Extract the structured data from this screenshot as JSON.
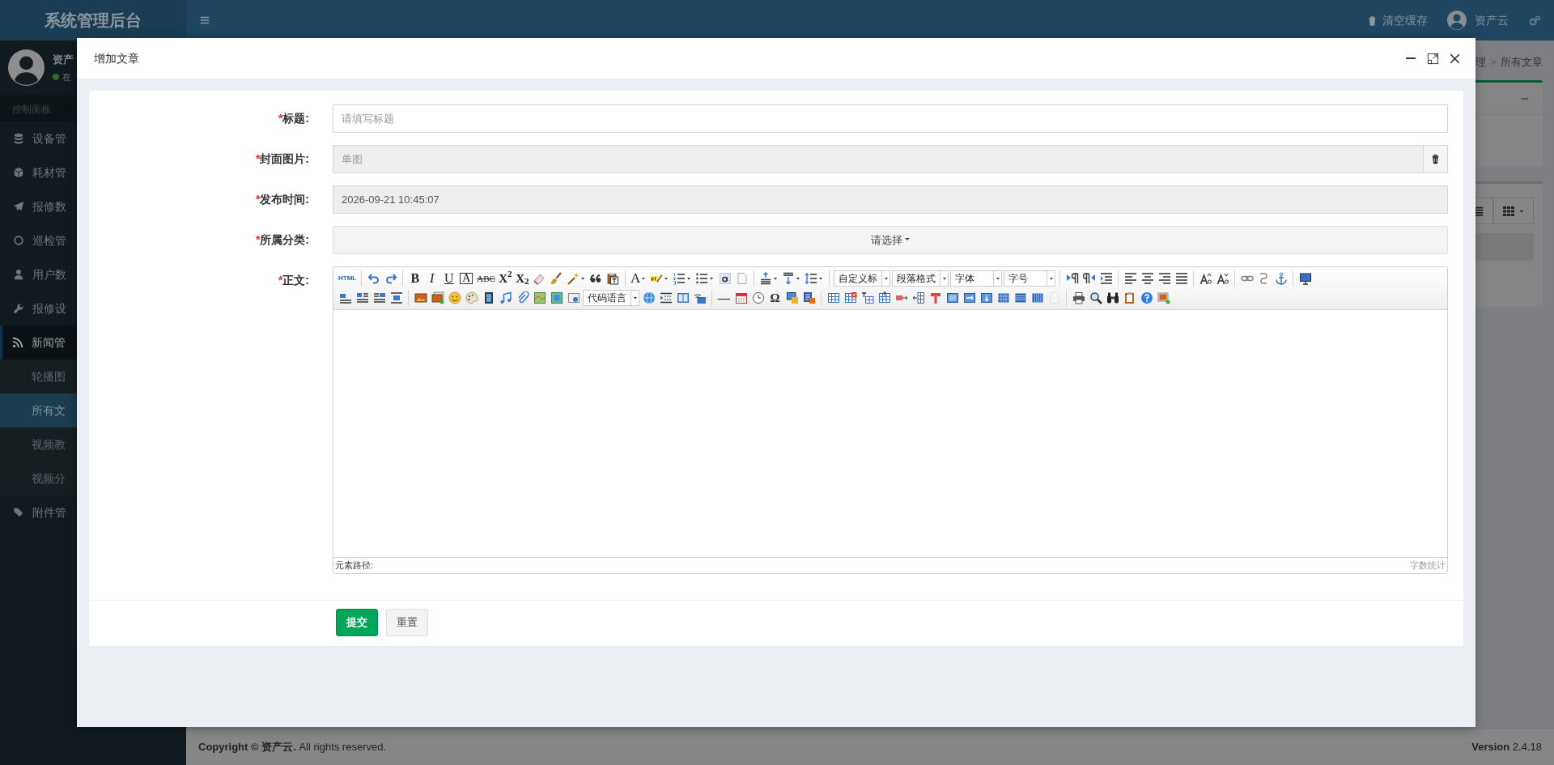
{
  "header": {
    "logo": "系统管理后台",
    "clear_cache": "清空缓存",
    "user": "资产云"
  },
  "sidebar": {
    "user": "资产",
    "status": "在",
    "online": true,
    "section": "控制面板",
    "items": [
      {
        "label": "设备管",
        "expanded": false
      },
      {
        "label": "耗材管",
        "expanded": false
      },
      {
        "label": "报修数",
        "expanded": false
      },
      {
        "label": "巡检管",
        "expanded": false
      },
      {
        "label": "用户数",
        "expanded": false
      },
      {
        "label": "报修设",
        "expanded": false
      },
      {
        "label": "新闻管",
        "expanded": true,
        "children": [
          {
            "label": "轮播图",
            "selected": false
          },
          {
            "label": "所有文",
            "selected": true
          },
          {
            "label": "视频教",
            "selected": false
          },
          {
            "label": "视频分",
            "selected": false
          }
        ]
      },
      {
        "label": "附件管",
        "expanded": false
      }
    ]
  },
  "content": {
    "breadcrumb": [
      {
        "label": "理"
      },
      {
        "label": "所有文章"
      }
    ],
    "separator": ">"
  },
  "modal": {
    "title": "增加文章",
    "fields": [
      {
        "kind": "text",
        "required_mark": "*",
        "label": "标题:",
        "placeholder": "请填写标题"
      },
      {
        "kind": "image",
        "required_mark": "*",
        "label": "封面图片:",
        "placeholder": "单图"
      },
      {
        "kind": "datetime",
        "required_mark": "*",
        "label": "发布时间:",
        "value": "2026-09-21 10:45:07"
      },
      {
        "kind": "select",
        "required_mark": "*",
        "label": "所属分类:",
        "value": "请选择"
      },
      {
        "kind": "editor",
        "required_mark": "*",
        "label": "正文:"
      }
    ],
    "editor": {
      "toolbar": [
        [
          {
            "kind": "small",
            "text": "HTML"
          },
          {
            "kind": "sep"
          },
          {
            "kind": "icon"
          },
          {
            "kind": "icon"
          },
          {
            "kind": "sep"
          },
          {
            "kind": "bold",
            "text": "B"
          },
          {
            "kind": "italic",
            "text": "I"
          },
          {
            "kind": "underline",
            "text": "U"
          },
          {
            "kind": "boxed",
            "text": "A"
          },
          {
            "kind": "struck",
            "text": "ABC"
          },
          {
            "kind": "glyph",
            "text": "X$^{2}$"
          },
          {
            "kind": "glyph",
            "text": "X$_{2}$"
          },
          {
            "kind": "icon"
          },
          {
            "kind": "icon"
          },
          {
            "kind": "menuicon"
          },
          {
            "kind": "icon"
          },
          {
            "kind": "icon"
          },
          {
            "kind": "sep"
          },
          {
            "kind": "menuglyph",
            "text": "A"
          },
          {
            "kind": "menuicon"
          },
          {
            "kind": "menuicon"
          },
          {
            "kind": "menuicon"
          },
          {
            "kind": "icon"
          },
          {
            "kind": "icon"
          },
          {
            "kind": "sep"
          },
          {
            "kind": "menuicon"
          },
          {
            "kind": "menuicon"
          },
          {
            "kind": "menuicon"
          },
          {
            "kind": "sep"
          },
          {
            "kind": "select",
            "text": "自定义标"
          },
          {
            "kind": "select",
            "text": "段落格式"
          },
          {
            "kind": "select",
            "text": "字体"
          },
          {
            "kind": "select",
            "text": "字号"
          },
          {
            "kind": "sep"
          },
          {
            "kind": "icon"
          },
          {
            "kind": "icon"
          },
          {
            "kind": "icon"
          },
          {
            "kind": "sep"
          },
          {
            "kind": "icon"
          },
          {
            "kind": "icon"
          },
          {
            "kind": "icon"
          },
          {
            "kind": "icon"
          },
          {
            "kind": "sep"
          },
          {
            "kind": "icon"
          },
          {
            "kind": "icon"
          },
          {
            "kind": "sep"
          },
          {
            "kind": "icon"
          },
          {
            "kind": "icon"
          },
          {
            "kind": "icon"
          },
          {
            "kind": "sep"
          },
          {
            "kind": "icon"
          }
        ],
        [
          {
            "kind": "icon"
          },
          {
            "kind": "icon"
          },
          {
            "kind": "icon"
          },
          {
            "kind": "icon"
          },
          {
            "kind": "sep"
          },
          {
            "kind": "icon"
          },
          {
            "kind": "icon"
          },
          {
            "kind": "icon"
          },
          {
            "kind": "icon"
          },
          {
            "kind": "icon"
          },
          {
            "kind": "icon"
          },
          {
            "kind": "icon"
          },
          {
            "kind": "icon"
          },
          {
            "kind": "icon"
          },
          {
            "kind": "icon"
          },
          {
            "kind": "select",
            "text": "代码语言"
          },
          {
            "kind": "icon"
          },
          {
            "kind": "icon"
          },
          {
            "kind": "icon"
          },
          {
            "kind": "icon"
          },
          {
            "kind": "sep"
          },
          {
            "kind": "glyph",
            "text": "—"
          },
          {
            "kind": "icon"
          },
          {
            "kind": "icon"
          },
          {
            "kind": "glyph",
            "text": "Ω"
          },
          {
            "kind": "icon"
          },
          {
            "kind": "icon"
          },
          {
            "kind": "sep"
          },
          {
            "kind": "icon"
          },
          {
            "kind": "icon"
          },
          {
            "kind": "icon"
          },
          {
            "kind": "icon"
          },
          {
            "kind": "icon"
          },
          {
            "kind": "icon"
          },
          {
            "kind": "icon"
          },
          {
            "kind": "icon"
          },
          {
            "kind": "icon"
          },
          {
            "kind": "icon"
          },
          {
            "kind": "icon"
          },
          {
            "kind": "icon"
          },
          {
            "kind": "icon"
          },
          {
            "kind": "icon"
          },
          {
            "kind": "sep"
          },
          {
            "kind": "icon"
          },
          {
            "kind": "icon"
          },
          {
            "kind": "icon"
          },
          {
            "kind": "icon"
          },
          {
            "kind": "icon"
          },
          {
            "kind": "icon"
          }
        ]
      ],
      "path_label": "元素路径:",
      "word_count": "字数统计"
    },
    "buttons": [
      {
        "label": "提交",
        "kind": "primary"
      },
      {
        "label": "重置",
        "kind": "default"
      }
    ]
  },
  "footer": {
    "copyright": "**Copyright © 资产云.** All rights reserved.",
    "version": "**Version** 2.4.18"
  }
}
